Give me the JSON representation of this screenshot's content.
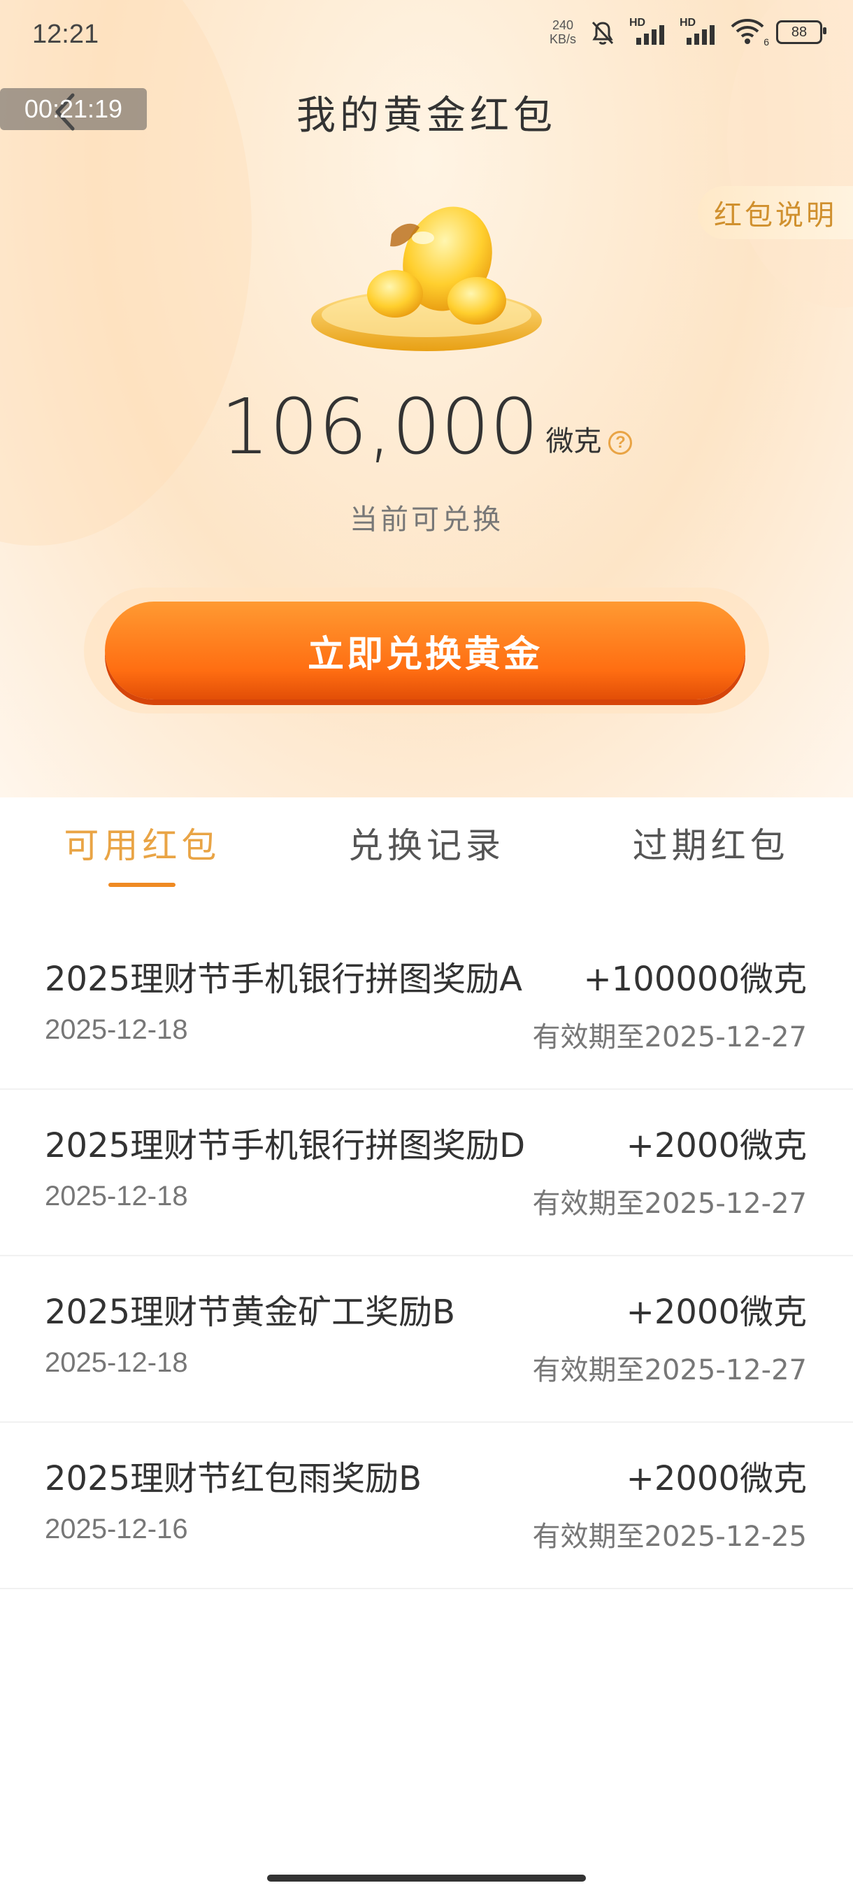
{
  "status_bar": {
    "time": "12:21",
    "net_speed_value": "240",
    "net_speed_unit": "KB/s",
    "hd_label": "HD",
    "wifi_badge": "6",
    "battery": "88"
  },
  "header": {
    "timer": "00:21:19",
    "title": "我的黄金红包",
    "rules_label": "红包说明"
  },
  "summary": {
    "amount": "106,000",
    "unit": "微克",
    "help_glyph": "?",
    "caption": "当前可兑换",
    "exchange_label": "立即兑换黄金"
  },
  "tabs": [
    {
      "label": "可用红包",
      "active": true
    },
    {
      "label": "兑换记录",
      "active": false
    },
    {
      "label": "过期红包",
      "active": false
    }
  ],
  "items": [
    {
      "title": "2025理财节手机银行拼图奖励A",
      "amount": "+100000微克",
      "date": "2025-12-18",
      "expiry": "有效期至2025-12-27"
    },
    {
      "title": "2025理财节手机银行拼图奖励D",
      "amount": "+2000微克",
      "date": "2025-12-18",
      "expiry": "有效期至2025-12-27"
    },
    {
      "title": "2025理财节黄金矿工奖励B",
      "amount": "+2000微克",
      "date": "2025-12-18",
      "expiry": "有效期至2025-12-27"
    },
    {
      "title": "2025理财节红包雨奖励B",
      "amount": "+2000微克",
      "date": "2025-12-16",
      "expiry": "有效期至2025-12-25"
    }
  ],
  "colors": {
    "accent": "#e9a445",
    "button": "#ff7a1a"
  }
}
